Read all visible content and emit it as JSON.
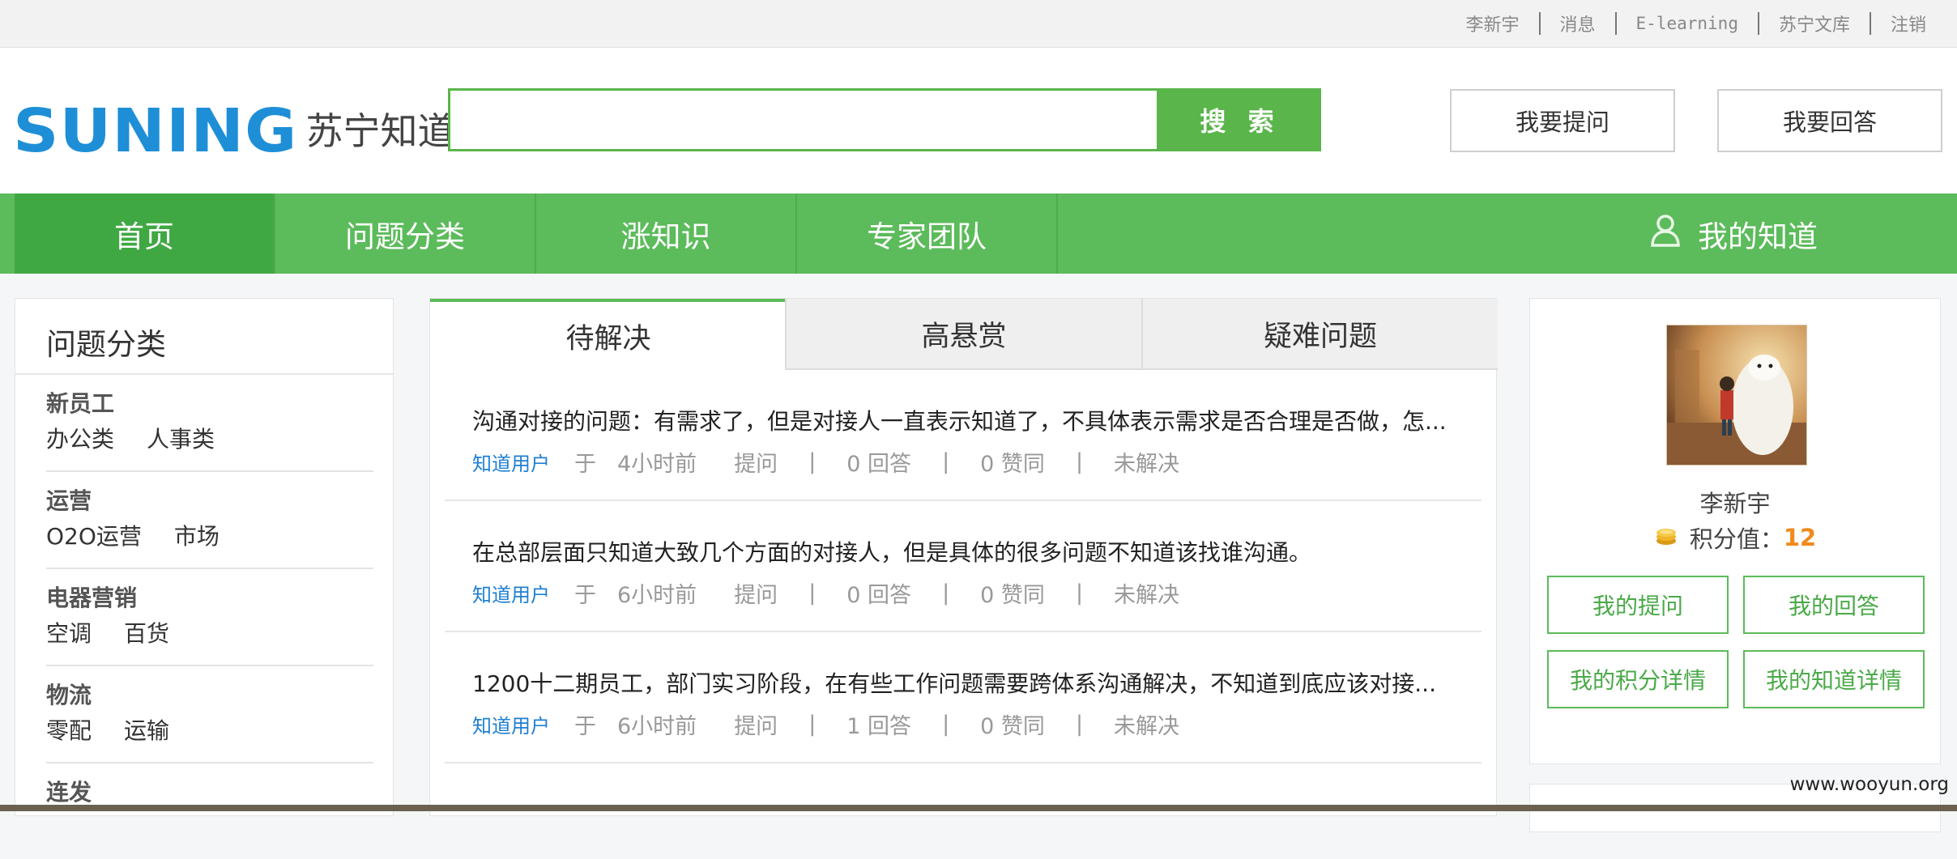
{
  "topbar": {
    "links": [
      "李新宇",
      "消息",
      "E-learning",
      "苏宁文库",
      "注销"
    ]
  },
  "header": {
    "logo_text": "SUNING",
    "logo_sub": "苏宁知道",
    "search_placeholder": "",
    "search_value": "",
    "search_button": "搜 索",
    "ask_button": "我要提问",
    "answer_button": "我要回答"
  },
  "nav": {
    "items": [
      "首页",
      "问题分类",
      "涨知识",
      "专家团队"
    ],
    "active": "首页",
    "my_zhidao": "我的知道"
  },
  "sidebar": {
    "title": "问题分类",
    "categories": [
      {
        "name": "新员工",
        "links": [
          "办公类",
          "人事类"
        ]
      },
      {
        "name": "运营",
        "links": [
          "O2O运营",
          "市场"
        ]
      },
      {
        "name": "电器营销",
        "links": [
          "空调",
          "百货"
        ]
      },
      {
        "name": "物流",
        "links": [
          "零配",
          "运输"
        ]
      },
      {
        "name": "连发",
        "links": []
      }
    ]
  },
  "center": {
    "tabs": [
      "待解决",
      "高悬赏",
      "疑难问题"
    ],
    "active_tab": "待解决",
    "questions": [
      {
        "title": "沟通对接的问题：有需求了，但是对接人一直表示知道了，不具体表示需求是否合理是否做，怎...",
        "user": "知道用户",
        "at": "于",
        "time": "4小时前",
        "action": "提问",
        "answers": "0 回答",
        "likes": "0 赞同",
        "status": "未解决"
      },
      {
        "title": "在总部层面只知道大致几个方面的对接人，但是具体的很多问题不知道该找谁沟通。",
        "user": "知道用户",
        "at": "于",
        "time": "6小时前",
        "action": "提问",
        "answers": "0 回答",
        "likes": "0 赞同",
        "status": "未解决"
      },
      {
        "title": "1200十二期员工，部门实习阶段，在有些工作问题需要跨体系沟通解决，不知道到底应该对接...",
        "user": "知道用户",
        "at": "于",
        "time": "6小时前",
        "action": "提问",
        "answers": "1 回答",
        "likes": "0 赞同",
        "status": "未解决"
      }
    ]
  },
  "profile": {
    "name": "李新宇",
    "score_label": "积分值：",
    "score_value": "12",
    "buttons": [
      "我的提问",
      "我的回答",
      "我的积分详情",
      "我的知道详情"
    ]
  },
  "watermark": "www.wooyun.org",
  "colors": {
    "brand_green": "#5cbb5b",
    "active_green": "#3fa843",
    "logo_blue": "#1e8fd6",
    "user_blue": "#1f7fd2",
    "score_orange": "#f08a1c"
  }
}
